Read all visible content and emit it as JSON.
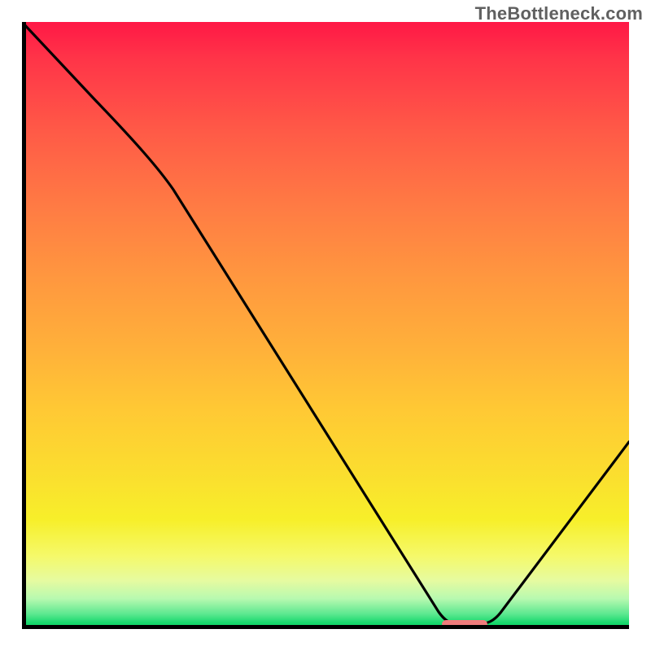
{
  "attribution": "TheBottleneck.com",
  "chart_data": {
    "type": "line",
    "title": "",
    "xlabel": "",
    "ylabel": "",
    "xlim": [
      0,
      100
    ],
    "ylim": [
      0,
      100
    ],
    "grid": false,
    "legend": false,
    "x": [
      0,
      24,
      70,
      76,
      100
    ],
    "values": [
      100,
      74,
      2,
      2,
      32
    ],
    "annotations": [
      {
        "type": "marker",
        "shape": "rounded-rect",
        "color": "#ef7b7b",
        "x_range": [
          70,
          76
        ],
        "y": 0.6
      }
    ],
    "background": {
      "type": "vertical-gradient",
      "interpretation": "green (bottom) = good / no bottleneck, red (top) = severe bottleneck",
      "stops": [
        {
          "pos": 0,
          "color": "#ff1846"
        },
        {
          "pos": 50,
          "color": "#ffb13a"
        },
        {
          "pos": 85,
          "color": "#f7ef2a"
        },
        {
          "pos": 100,
          "color": "#0ace5e"
        }
      ]
    }
  }
}
